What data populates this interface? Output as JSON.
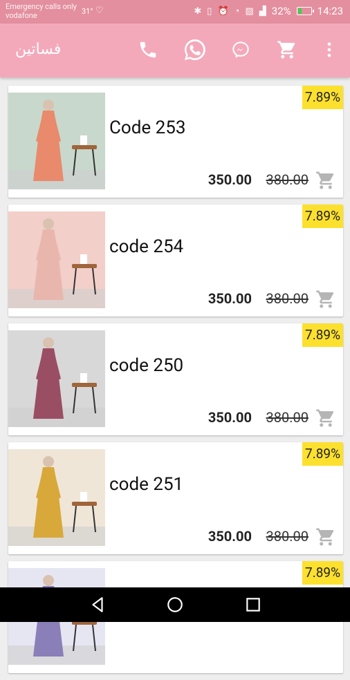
{
  "status": {
    "carrier_line1": "Emergency calls only",
    "carrier_line2": "vodafone",
    "temperature": "31°",
    "battery": "32%",
    "battery_level": 0.32,
    "time": "14:23"
  },
  "appbar": {
    "title": "فساتين",
    "actions": [
      "phone-icon",
      "whatsapp-icon",
      "messenger-icon",
      "cart-icon",
      "overflow-menu-icon"
    ]
  },
  "products": [
    {
      "name": "Code 253",
      "discount": "7.89%",
      "price": "350.00",
      "old_price": "380.00",
      "image_colors": [
        "#c8d8cc",
        "#e88a6b"
      ]
    },
    {
      "name": "code 254",
      "discount": "7.89%",
      "price": "350.00",
      "old_price": "380.00",
      "image_colors": [
        "#f2cfc8",
        "#e9b6ad"
      ]
    },
    {
      "name": "code 250",
      "discount": "7.89%",
      "price": "350.00",
      "old_price": "380.00",
      "image_colors": [
        "#d8d8d8",
        "#9a4e63"
      ]
    },
    {
      "name": "code 251",
      "discount": "7.89%",
      "price": "350.00",
      "old_price": "380.00",
      "image_colors": [
        "#efe6d8",
        "#d9a83a"
      ]
    },
    {
      "name": "",
      "discount": "7.89%",
      "price": "",
      "old_price": "",
      "image_colors": [
        "#e6e6f2",
        "#8a7fb8"
      ]
    }
  ],
  "nav": [
    "back-icon",
    "home-icon",
    "recents-icon"
  ]
}
